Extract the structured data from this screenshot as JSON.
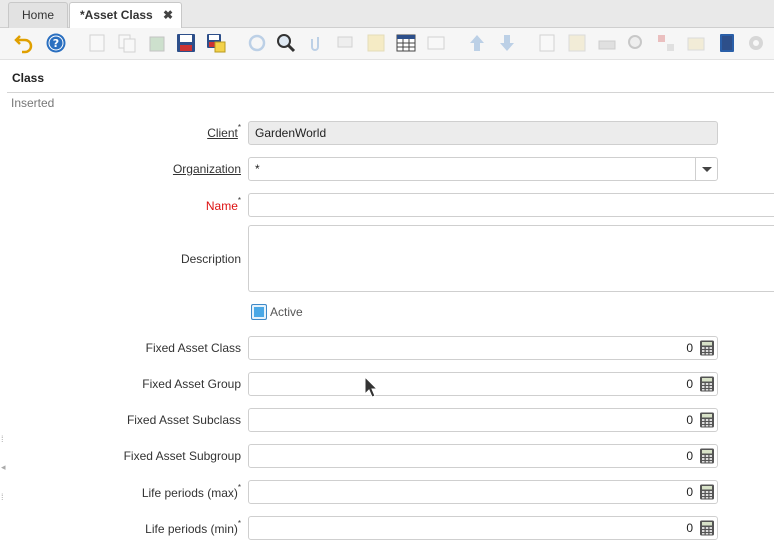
{
  "tabs": {
    "home": "Home",
    "active": "*Asset Class",
    "close": "✖"
  },
  "toolbar": {
    "icons": [
      "undo-icon",
      "help-icon",
      "new-icon",
      "copy-icon",
      "delete-icon",
      "save-icon",
      "save-new-icon",
      "refresh-icon",
      "find-icon",
      "attachment-icon",
      "chat-icon",
      "note-icon",
      "grid-toggle-icon",
      "detail-icon",
      "up-icon",
      "down-icon",
      "report-icon",
      "archive-icon",
      "print-icon",
      "zoom-across-icon",
      "workflow-icon",
      "product-icon",
      "export-icon",
      "customize-icon",
      "settings-icon"
    ]
  },
  "window": {
    "title": "Class",
    "status": "Inserted"
  },
  "form": {
    "client": {
      "label": "Client",
      "value": "GardenWorld"
    },
    "organization": {
      "label": "Organization",
      "value": "*"
    },
    "name": {
      "label": "Name",
      "value": ""
    },
    "description": {
      "label": "Description",
      "value": ""
    },
    "active": {
      "label": "Active",
      "checked": true
    },
    "fixed_asset_class": {
      "label": "Fixed Asset Class",
      "value": "0"
    },
    "fixed_asset_group": {
      "label": "Fixed Asset Group",
      "value": "0"
    },
    "fixed_asset_subclass": {
      "label": "Fixed Asset Subclass",
      "value": "0"
    },
    "fixed_asset_subgroup": {
      "label": "Fixed Asset Subgroup",
      "value": "0"
    },
    "life_periods_max": {
      "label": "Life periods (max)",
      "value": "0"
    },
    "life_periods_min": {
      "label": "Life periods (min)",
      "value": "0"
    },
    "required_mark": "*"
  },
  "colors": {
    "accent": "#4aa8e6",
    "required": "#dd1111"
  }
}
